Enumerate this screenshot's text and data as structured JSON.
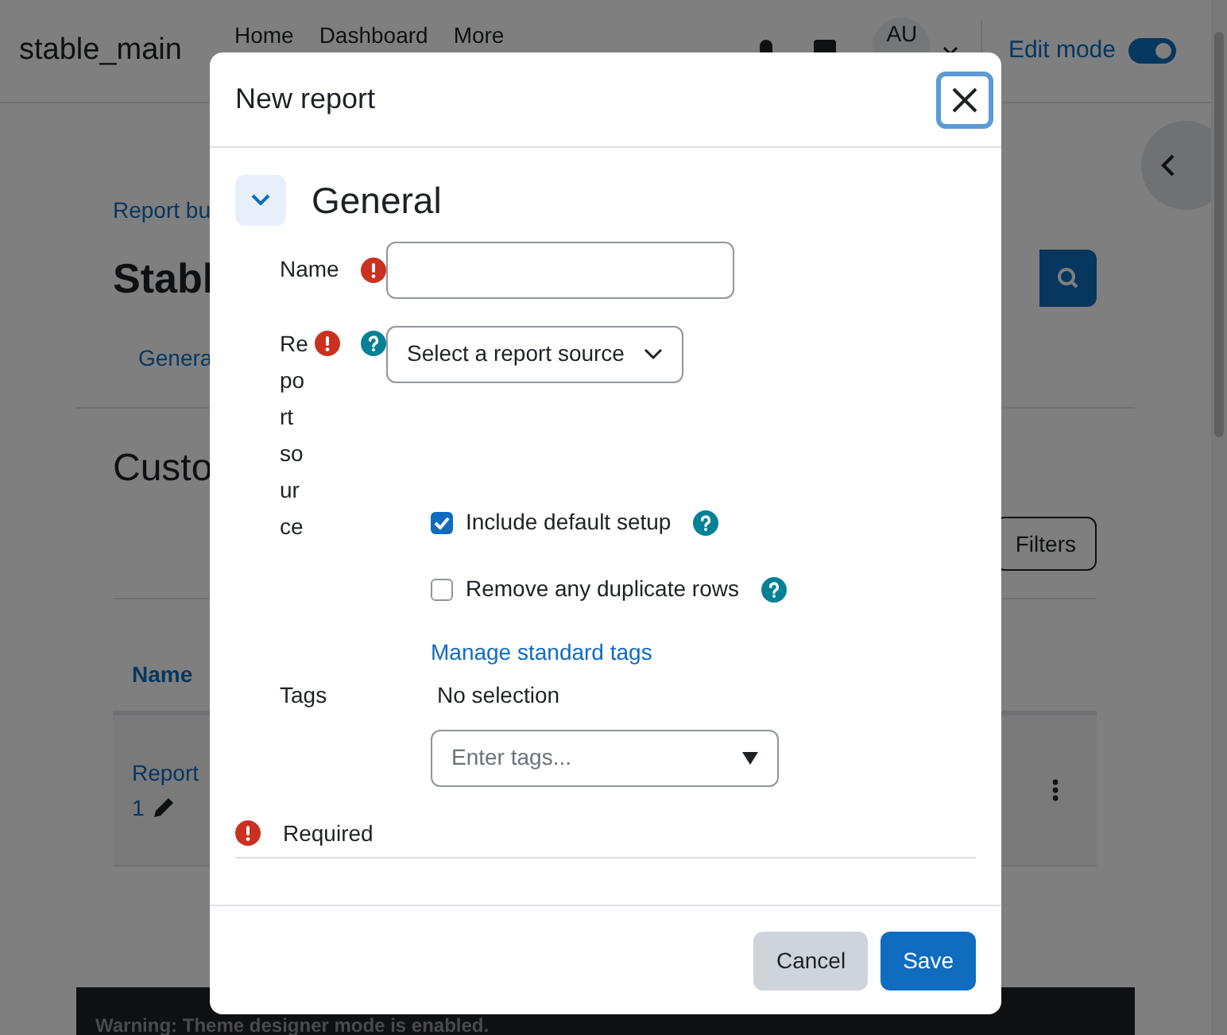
{
  "page": {
    "site_name": "stable_main",
    "nav": [
      {
        "label": "Home"
      },
      {
        "label": "Dashboard"
      },
      {
        "label": "More"
      }
    ],
    "avatar": "AU",
    "edit_mode": {
      "label": "Edit mode",
      "on": true
    },
    "breadcrumb": "Report bu",
    "heading": "Stabl",
    "tab": "Genera",
    "section_heading": "Custo",
    "filters_button": "Filters",
    "table": {
      "columns": [
        "Name"
      ],
      "rows": [
        {
          "name": "Report",
          "name_line_2": "1"
        }
      ]
    },
    "warning": "Warning: Theme designer mode is enabled."
  },
  "dialog": {
    "title": "New report",
    "section": {
      "title": "General",
      "expanded": true
    },
    "fields": [
      {
        "kind": "text",
        "label": "Name",
        "required": true,
        "help": false
      },
      {
        "kind": "select",
        "label": "Report source",
        "required": true,
        "help": true,
        "value": "Select a report source"
      },
      {
        "kind": "checkbox",
        "label": "Include default setup",
        "checked": true,
        "help": true
      },
      {
        "kind": "checkbox",
        "label": "Remove any duplicate rows",
        "checked": false,
        "help": true
      },
      {
        "kind": "tags",
        "label": "Tags",
        "link": "Manage standard tags",
        "selection": "No selection",
        "placeholder": "Enter tags..."
      }
    ],
    "required_note": "Required",
    "buttons": [
      {
        "label": "Cancel",
        "kind": "secondary"
      },
      {
        "label": "Save",
        "kind": "primary"
      }
    ]
  }
}
